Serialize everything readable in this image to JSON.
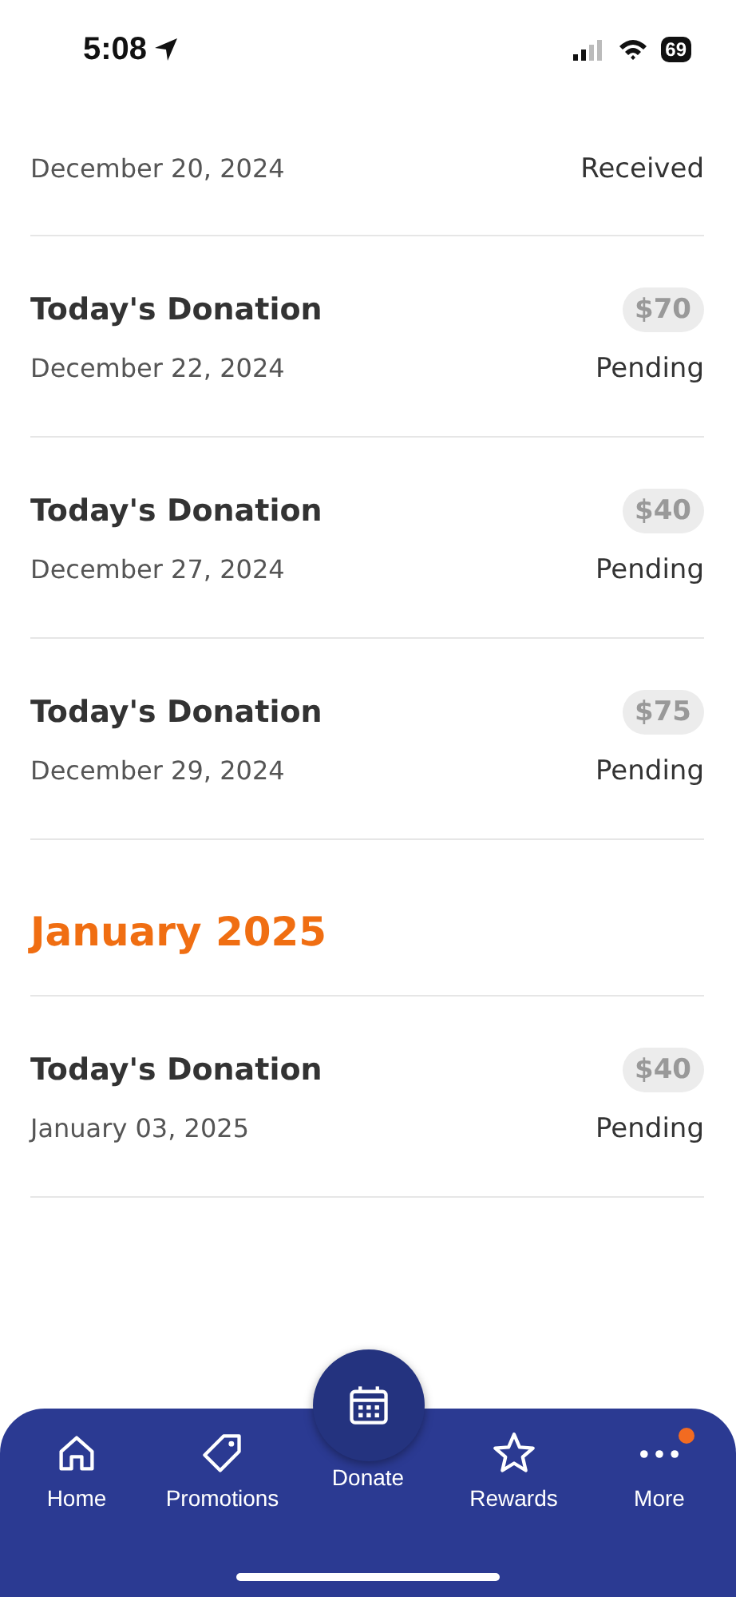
{
  "status_bar": {
    "time": "5:08",
    "battery": "69"
  },
  "donations": [
    {
      "kind": "partial",
      "date": "December 20, 2024",
      "status": "Received"
    },
    {
      "kind": "row",
      "title": "Today's Donation",
      "amount": "$70",
      "date": "December 22, 2024",
      "status": "Pending"
    },
    {
      "kind": "row",
      "title": "Today's Donation",
      "amount": "$40",
      "date": "December 27, 2024",
      "status": "Pending"
    },
    {
      "kind": "row",
      "title": "Today's Donation",
      "amount": "$75",
      "date": "December 29, 2024",
      "status": "Pending"
    },
    {
      "kind": "month",
      "title": "January 2025"
    },
    {
      "kind": "row",
      "title": "Today's Donation",
      "amount": "$40",
      "date": "January 03, 2025",
      "status": "Pending"
    }
  ],
  "tab_bar": [
    {
      "label": "Home",
      "selected": false,
      "badge": false
    },
    {
      "label": "Promotions",
      "selected": false,
      "badge": false
    },
    {
      "label": "Donate",
      "selected": true,
      "badge": false
    },
    {
      "label": "Rewards",
      "selected": false,
      "badge": false
    },
    {
      "label": "More",
      "selected": false,
      "badge": true
    }
  ]
}
